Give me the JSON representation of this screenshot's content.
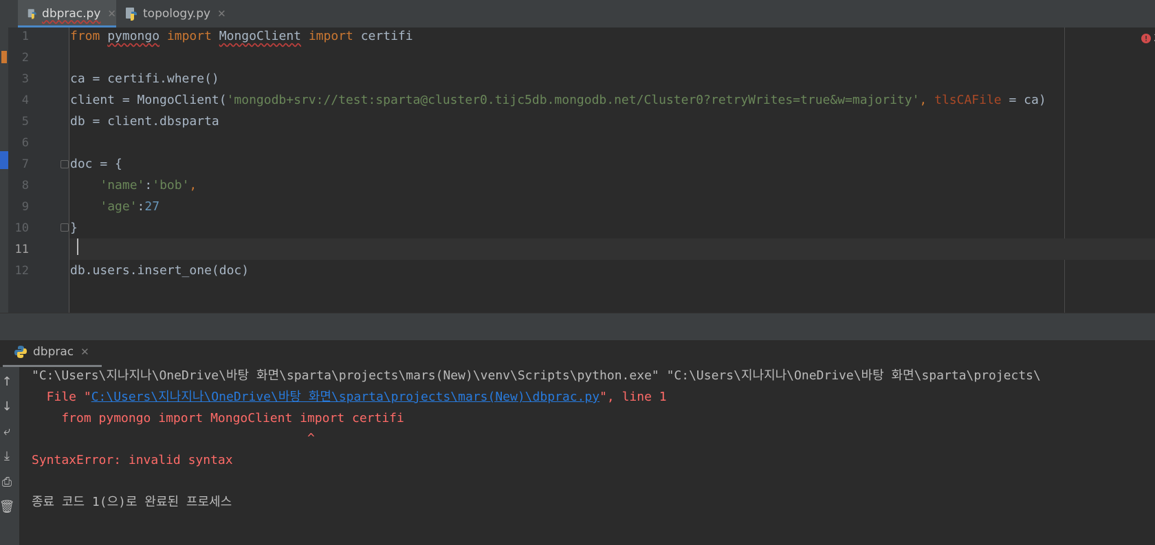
{
  "tabs": [
    {
      "label": "dbprac.py",
      "active": true
    },
    {
      "label": "topology.py",
      "active": false
    }
  ],
  "editor": {
    "line_numbers": [
      "1",
      "2",
      "3",
      "4",
      "5",
      "6",
      "7",
      "8",
      "9",
      "10",
      "11",
      "12"
    ],
    "error_count": "3",
    "lines": {
      "l1": {
        "kw1": "from",
        "mod": "pymongo",
        "kw2": "import",
        "cls": "MongoClient",
        "kw3": "import",
        "name": "certifi"
      },
      "l3": {
        "text": "ca = certifi.where()"
      },
      "l4": {
        "pre": "client = MongoClient(",
        "url": "'mongodb+srv://test:sparta@cluster0.tijc5db.mongodb.net/Cluster0?retryWrites=true&w=majority'",
        "comma": ", ",
        "param": "tlsCAFile",
        "post": " = ca)"
      },
      "l5": {
        "text": "db = client.dbsparta"
      },
      "l7": {
        "text": "doc = {"
      },
      "l8": {
        "indent": "    ",
        "key": "'name'",
        "colon": ":",
        "val": "'bob'",
        "comma": ","
      },
      "l9": {
        "indent": "    ",
        "key": "'age'",
        "colon": ":",
        "num": "27"
      },
      "l10": {
        "text": "}"
      },
      "l12": {
        "text": "db.users.insert_one(doc)"
      }
    }
  },
  "run_panel": {
    "tab_label": "dbprac",
    "console": {
      "cmd": "\"C:\\Users\\지나지나\\OneDrive\\바탕 화면\\sparta\\projects\\mars(New)\\venv\\Scripts\\python.exe\" \"C:\\Users\\지나지나\\OneDrive\\바탕 화면\\sparta\\projects\\",
      "file_prefix": "  File \"",
      "file_link": "C:\\Users\\지나지나\\OneDrive\\바탕 화면\\sparta\\projects\\mars(New)\\dbprac.py",
      "file_suffix": "\", line 1",
      "code": "    from pymongo import MongoClient import certifi",
      "caret": "                                     ^",
      "error": "SyntaxError: invalid syntax",
      "exit": "종료 코드 1(으)로 완료된 프로세스"
    }
  },
  "icons": [
    "python-file-icon",
    "close-icon",
    "error-icon",
    "arrow-up-icon",
    "arrow-down-icon",
    "soft-wrap-icon",
    "scroll-to-end-icon",
    "print-icon",
    "trash-icon"
  ],
  "colors": {
    "keyword": "#cc7832",
    "string": "#6a8759",
    "number": "#6897bb",
    "param": "#aa4926",
    "error": "#ff6b68",
    "link": "#287bde",
    "accent": "#4a88c7"
  }
}
